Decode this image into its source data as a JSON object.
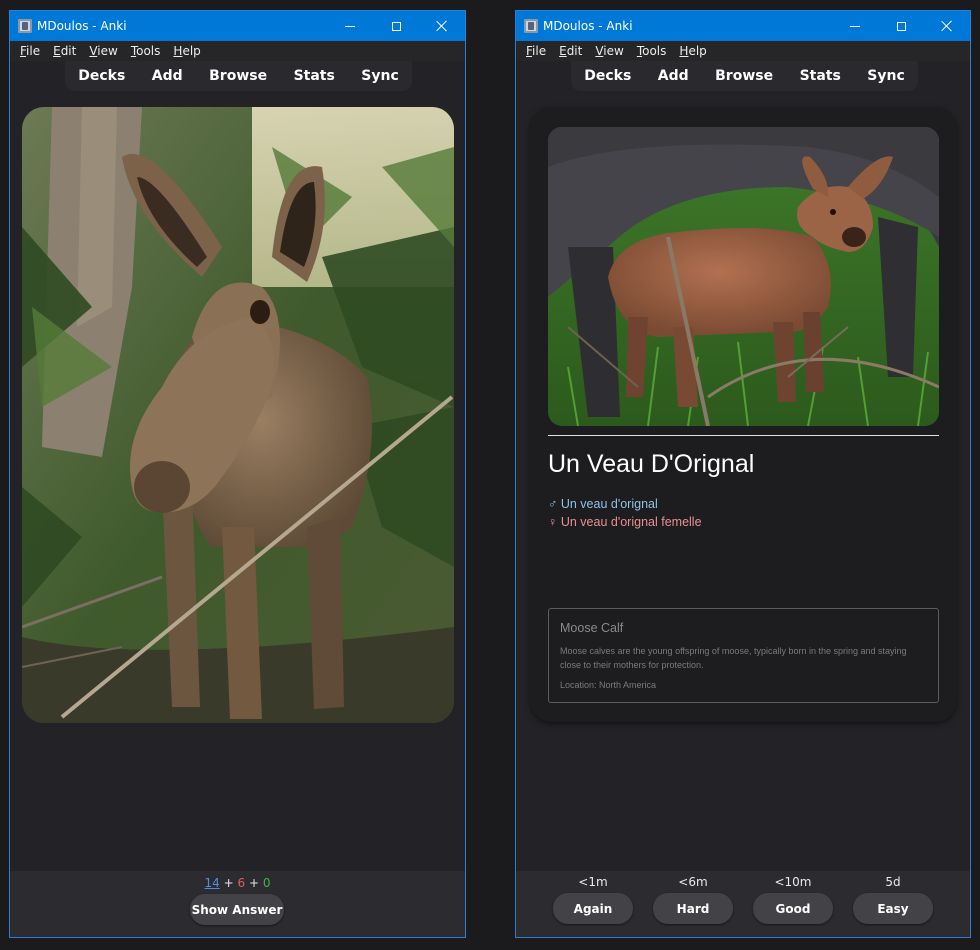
{
  "windows": {
    "left": {
      "title": "MDoulos - Anki",
      "menu": [
        {
          "u": "F",
          "rest": "ile"
        },
        {
          "u": "E",
          "rest": "dit"
        },
        {
          "u": "V",
          "rest": "iew"
        },
        {
          "u": "T",
          "rest": "ools"
        },
        {
          "u": "H",
          "rest": "elp"
        }
      ],
      "toolbar": [
        "Decks",
        "Add",
        "Browse",
        "Stats",
        "Sync"
      ],
      "counts": {
        "new": "14",
        "learn": "6",
        "review": "0",
        "sep": "+"
      },
      "show_answer_label": "Show Answer",
      "front_image_icon": "moose-calf-photo"
    },
    "right": {
      "title": "MDoulos - Anki",
      "menu": [
        {
          "u": "F",
          "rest": "ile"
        },
        {
          "u": "E",
          "rest": "dit"
        },
        {
          "u": "V",
          "rest": "iew"
        },
        {
          "u": "T",
          "rest": "ools"
        },
        {
          "u": "H",
          "rest": "elp"
        }
      ],
      "toolbar": [
        "Decks",
        "Add",
        "Browse",
        "Stats",
        "Sync"
      ],
      "card": {
        "title": "Un Veau D'Orignal",
        "male_symbol": "♂",
        "male_text": "Un veau d'orignal",
        "female_symbol": "♀",
        "female_text": "Un veau d'orignal femelle",
        "info_title": "Moose Calf",
        "info_desc": "Moose calves are the young offspring of moose, typically born in the spring and staying close to their mothers for protection.",
        "info_location": "Location: North America"
      },
      "answers": [
        {
          "time": "<1m",
          "label": "Again"
        },
        {
          "time": "<6m",
          "label": "Hard"
        },
        {
          "time": "<10m",
          "label": "Good"
        },
        {
          "time": "5d",
          "label": "Easy"
        }
      ]
    }
  },
  "colors": {
    "titlebar": "#0078d7",
    "new_count": "#4d8fd9",
    "learn_count": "#e05c5c",
    "review_count": "#39b54a",
    "male": "#8fc0e6",
    "female": "#e98f93"
  }
}
